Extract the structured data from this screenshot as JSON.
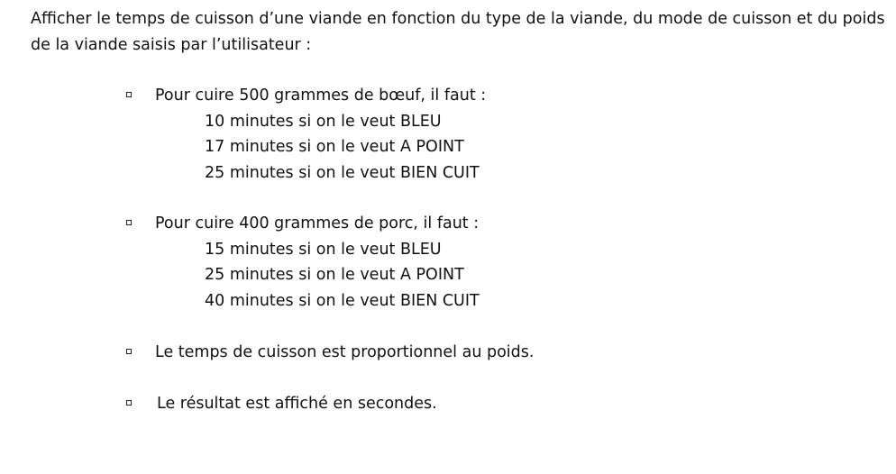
{
  "intro": "Afficher le temps de cuisson d’une viande en fonction du type de la viande, du mode de cuisson et du poids de la viande saisis par l’utilisateur :",
  "bullets": [
    {
      "text": "Pour cuire 500 grammes de bœuf, il faut :",
      "lines": [
        "10 minutes si on le veut BLEU",
        "17 minutes si on le veut A POINT",
        "25 minutes si on le veut BIEN CUIT"
      ]
    },
    {
      "text": "Pour cuire 400 grammes de porc, il faut :",
      "lines": [
        "15 minutes si on le veut BLEU",
        "25 minutes si on le veut A POINT",
        "40 minutes si on le veut BIEN CUIT"
      ]
    },
    {
      "text": "Le temps de cuisson est proportionnel au poids."
    },
    {
      "text": "Le résultat est affiché en secondes."
    }
  ]
}
